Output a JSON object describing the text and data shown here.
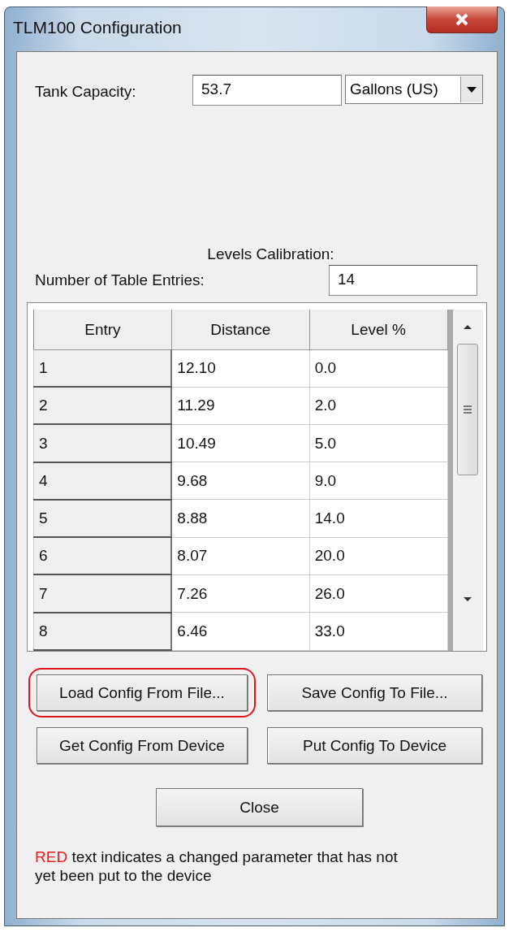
{
  "window": {
    "title": "TLM100 Configuration"
  },
  "tank_capacity": {
    "label": "Tank Capacity:",
    "value": "53.7",
    "unit": "Gallons (US)"
  },
  "levels_calibration": {
    "heading": "Levels Calibration:",
    "entries_label": "Number of Table Entries:",
    "entries_value": "14"
  },
  "table": {
    "columns": [
      "Entry",
      "Distance",
      "Level %"
    ],
    "rows": [
      [
        "1",
        "12.10",
        "0.0"
      ],
      [
        "2",
        "11.29",
        "2.0"
      ],
      [
        "3",
        "10.49",
        "5.0"
      ],
      [
        "4",
        "9.68",
        "9.0"
      ],
      [
        "5",
        "8.88",
        "14.0"
      ],
      [
        "6",
        "8.07",
        "20.0"
      ],
      [
        "7",
        "7.26",
        "26.0"
      ],
      [
        "8",
        "6.46",
        "33.0"
      ]
    ]
  },
  "buttons": [
    {
      "label": "Load Config From File...",
      "highlighted": true
    },
    {
      "label": "Save Config To File...",
      "highlighted": false
    },
    {
      "label": "Get Config From Device",
      "highlighted": false
    },
    {
      "label": "Put Config To Device",
      "highlighted": false
    },
    {
      "label": "Close",
      "highlighted": false
    }
  ],
  "note": {
    "marker": "RED",
    "text": "text indicates a changed parameter that has not yet been put to the device"
  }
}
